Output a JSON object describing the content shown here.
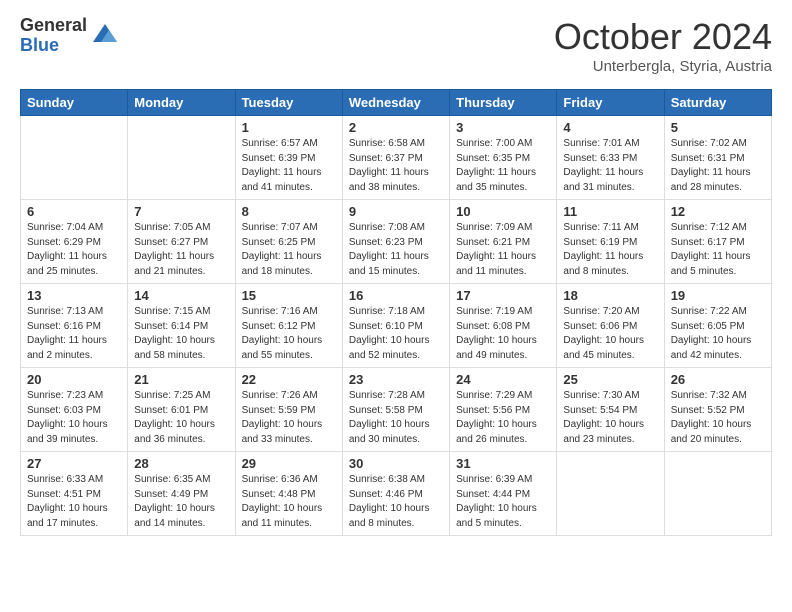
{
  "header": {
    "logo": {
      "general": "General",
      "blue": "Blue"
    },
    "title": "October 2024",
    "subtitle": "Unterbergla, Styria, Austria"
  },
  "weekdays": [
    "Sunday",
    "Monday",
    "Tuesday",
    "Wednesday",
    "Thursday",
    "Friday",
    "Saturday"
  ],
  "weeks": [
    [
      {
        "day": "",
        "sunrise": "",
        "sunset": "",
        "daylight": ""
      },
      {
        "day": "",
        "sunrise": "",
        "sunset": "",
        "daylight": ""
      },
      {
        "day": "1",
        "sunrise": "Sunrise: 6:57 AM",
        "sunset": "Sunset: 6:39 PM",
        "daylight": "Daylight: 11 hours and 41 minutes."
      },
      {
        "day": "2",
        "sunrise": "Sunrise: 6:58 AM",
        "sunset": "Sunset: 6:37 PM",
        "daylight": "Daylight: 11 hours and 38 minutes."
      },
      {
        "day": "3",
        "sunrise": "Sunrise: 7:00 AM",
        "sunset": "Sunset: 6:35 PM",
        "daylight": "Daylight: 11 hours and 35 minutes."
      },
      {
        "day": "4",
        "sunrise": "Sunrise: 7:01 AM",
        "sunset": "Sunset: 6:33 PM",
        "daylight": "Daylight: 11 hours and 31 minutes."
      },
      {
        "day": "5",
        "sunrise": "Sunrise: 7:02 AM",
        "sunset": "Sunset: 6:31 PM",
        "daylight": "Daylight: 11 hours and 28 minutes."
      }
    ],
    [
      {
        "day": "6",
        "sunrise": "Sunrise: 7:04 AM",
        "sunset": "Sunset: 6:29 PM",
        "daylight": "Daylight: 11 hours and 25 minutes."
      },
      {
        "day": "7",
        "sunrise": "Sunrise: 7:05 AM",
        "sunset": "Sunset: 6:27 PM",
        "daylight": "Daylight: 11 hours and 21 minutes."
      },
      {
        "day": "8",
        "sunrise": "Sunrise: 7:07 AM",
        "sunset": "Sunset: 6:25 PM",
        "daylight": "Daylight: 11 hours and 18 minutes."
      },
      {
        "day": "9",
        "sunrise": "Sunrise: 7:08 AM",
        "sunset": "Sunset: 6:23 PM",
        "daylight": "Daylight: 11 hours and 15 minutes."
      },
      {
        "day": "10",
        "sunrise": "Sunrise: 7:09 AM",
        "sunset": "Sunset: 6:21 PM",
        "daylight": "Daylight: 11 hours and 11 minutes."
      },
      {
        "day": "11",
        "sunrise": "Sunrise: 7:11 AM",
        "sunset": "Sunset: 6:19 PM",
        "daylight": "Daylight: 11 hours and 8 minutes."
      },
      {
        "day": "12",
        "sunrise": "Sunrise: 7:12 AM",
        "sunset": "Sunset: 6:17 PM",
        "daylight": "Daylight: 11 hours and 5 minutes."
      }
    ],
    [
      {
        "day": "13",
        "sunrise": "Sunrise: 7:13 AM",
        "sunset": "Sunset: 6:16 PM",
        "daylight": "Daylight: 11 hours and 2 minutes."
      },
      {
        "day": "14",
        "sunrise": "Sunrise: 7:15 AM",
        "sunset": "Sunset: 6:14 PM",
        "daylight": "Daylight: 10 hours and 58 minutes."
      },
      {
        "day": "15",
        "sunrise": "Sunrise: 7:16 AM",
        "sunset": "Sunset: 6:12 PM",
        "daylight": "Daylight: 10 hours and 55 minutes."
      },
      {
        "day": "16",
        "sunrise": "Sunrise: 7:18 AM",
        "sunset": "Sunset: 6:10 PM",
        "daylight": "Daylight: 10 hours and 52 minutes."
      },
      {
        "day": "17",
        "sunrise": "Sunrise: 7:19 AM",
        "sunset": "Sunset: 6:08 PM",
        "daylight": "Daylight: 10 hours and 49 minutes."
      },
      {
        "day": "18",
        "sunrise": "Sunrise: 7:20 AM",
        "sunset": "Sunset: 6:06 PM",
        "daylight": "Daylight: 10 hours and 45 minutes."
      },
      {
        "day": "19",
        "sunrise": "Sunrise: 7:22 AM",
        "sunset": "Sunset: 6:05 PM",
        "daylight": "Daylight: 10 hours and 42 minutes."
      }
    ],
    [
      {
        "day": "20",
        "sunrise": "Sunrise: 7:23 AM",
        "sunset": "Sunset: 6:03 PM",
        "daylight": "Daylight: 10 hours and 39 minutes."
      },
      {
        "day": "21",
        "sunrise": "Sunrise: 7:25 AM",
        "sunset": "Sunset: 6:01 PM",
        "daylight": "Daylight: 10 hours and 36 minutes."
      },
      {
        "day": "22",
        "sunrise": "Sunrise: 7:26 AM",
        "sunset": "Sunset: 5:59 PM",
        "daylight": "Daylight: 10 hours and 33 minutes."
      },
      {
        "day": "23",
        "sunrise": "Sunrise: 7:28 AM",
        "sunset": "Sunset: 5:58 PM",
        "daylight": "Daylight: 10 hours and 30 minutes."
      },
      {
        "day": "24",
        "sunrise": "Sunrise: 7:29 AM",
        "sunset": "Sunset: 5:56 PM",
        "daylight": "Daylight: 10 hours and 26 minutes."
      },
      {
        "day": "25",
        "sunrise": "Sunrise: 7:30 AM",
        "sunset": "Sunset: 5:54 PM",
        "daylight": "Daylight: 10 hours and 23 minutes."
      },
      {
        "day": "26",
        "sunrise": "Sunrise: 7:32 AM",
        "sunset": "Sunset: 5:52 PM",
        "daylight": "Daylight: 10 hours and 20 minutes."
      }
    ],
    [
      {
        "day": "27",
        "sunrise": "Sunrise: 6:33 AM",
        "sunset": "Sunset: 4:51 PM",
        "daylight": "Daylight: 10 hours and 17 minutes."
      },
      {
        "day": "28",
        "sunrise": "Sunrise: 6:35 AM",
        "sunset": "Sunset: 4:49 PM",
        "daylight": "Daylight: 10 hours and 14 minutes."
      },
      {
        "day": "29",
        "sunrise": "Sunrise: 6:36 AM",
        "sunset": "Sunset: 4:48 PM",
        "daylight": "Daylight: 10 hours and 11 minutes."
      },
      {
        "day": "30",
        "sunrise": "Sunrise: 6:38 AM",
        "sunset": "Sunset: 4:46 PM",
        "daylight": "Daylight: 10 hours and 8 minutes."
      },
      {
        "day": "31",
        "sunrise": "Sunrise: 6:39 AM",
        "sunset": "Sunset: 4:44 PM",
        "daylight": "Daylight: 10 hours and 5 minutes."
      },
      {
        "day": "",
        "sunrise": "",
        "sunset": "",
        "daylight": ""
      },
      {
        "day": "",
        "sunrise": "",
        "sunset": "",
        "daylight": ""
      }
    ]
  ]
}
